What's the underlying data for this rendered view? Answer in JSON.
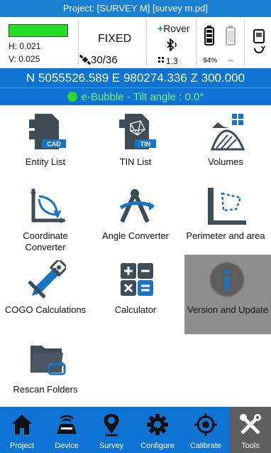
{
  "title_bar": {
    "text": "Project: [SURVEY M] [survey m.pd]"
  },
  "status": {
    "h_precision": "H: 0.021",
    "v_precision": "V: 0.025",
    "fix_state": "FIXED",
    "satellites": "30/36",
    "mode": "Rover",
    "pdop": "1.3",
    "battery_receiver": "94%",
    "battery_controller": "--",
    "fix_color": "#22dd22"
  },
  "coords": {
    "text": "N 5055526.589  E 980274.336  Z 300.000"
  },
  "bubble": {
    "text": "e-Bubble - Tilt angle : 0.0°"
  },
  "tools": [
    {
      "label": "Entity List",
      "icon": "cad-file-icon"
    },
    {
      "label": "TIN List",
      "icon": "tin-file-icon"
    },
    {
      "label": "Volumes",
      "icon": "volumes-icon"
    },
    {
      "label": "Coordinate Converter",
      "icon": "coordinate-converter-icon"
    },
    {
      "label": "Angle Converter",
      "icon": "angle-converter-icon"
    },
    {
      "label": "Perimeter and area",
      "icon": "perimeter-area-icon"
    },
    {
      "label": "COGO Calculations",
      "icon": "cogo-icon"
    },
    {
      "label": "Calculator",
      "icon": "calculator-icon"
    },
    {
      "label": "Version and Update",
      "icon": "info-icon"
    },
    {
      "label": "Rescan Folders",
      "icon": "folder-icon"
    }
  ],
  "nav": [
    {
      "label": "Project",
      "icon": "home-icon"
    },
    {
      "label": "Device",
      "icon": "device-icon"
    },
    {
      "label": "Survey",
      "icon": "survey-pin-icon"
    },
    {
      "label": "Configure",
      "icon": "configure-gear-icon"
    },
    {
      "label": "Calibrate",
      "icon": "calibrate-target-icon"
    },
    {
      "label": "Tools",
      "icon": "tools-icon"
    }
  ],
  "colors": {
    "primary": "#0d74d3",
    "title": "#1a7fd1",
    "selected_tile": "#8e8e8e",
    "active_nav": "#5e5e5e"
  }
}
